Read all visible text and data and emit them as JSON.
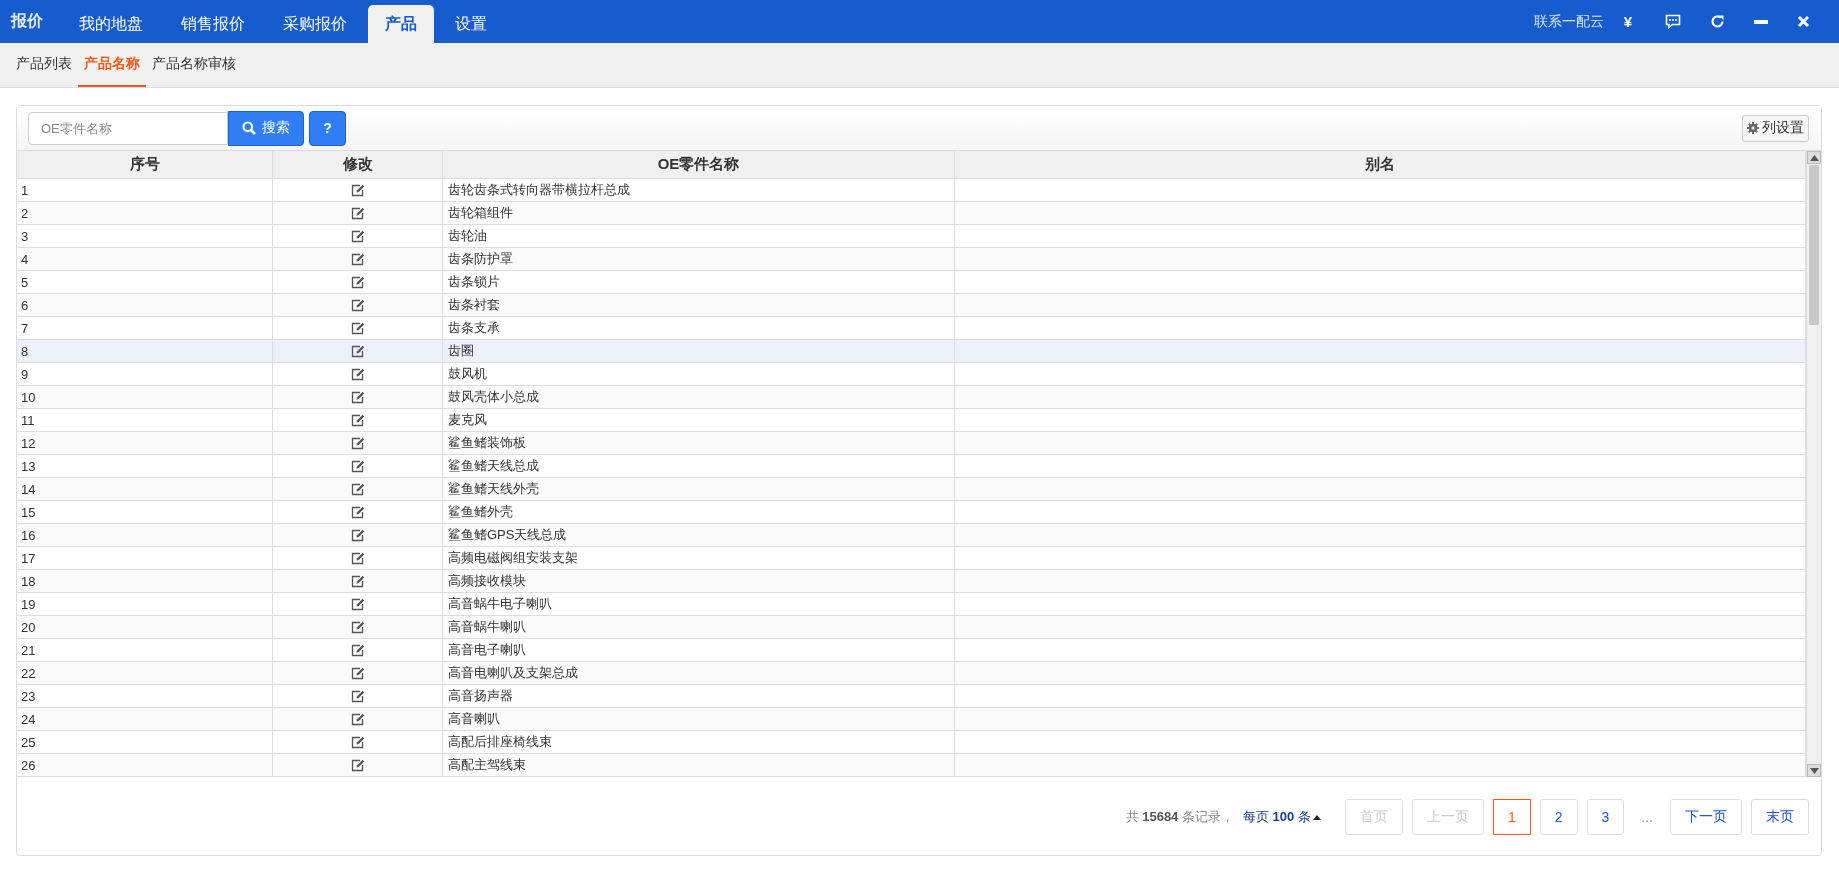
{
  "top_bar": {
    "brand": "报价",
    "tabs": [
      {
        "label": "我的地盘",
        "selected": false
      },
      {
        "label": "销售报价",
        "selected": false
      },
      {
        "label": "采购报价",
        "selected": false
      },
      {
        "label": "产品",
        "selected": true
      },
      {
        "label": "设置",
        "selected": false
      }
    ],
    "contact": "联系一配云",
    "currency": "¥"
  },
  "sub_tabs": [
    {
      "label": "产品列表",
      "selected": false
    },
    {
      "label": "产品名称",
      "selected": true
    },
    {
      "label": "产品名称审核",
      "selected": false
    }
  ],
  "toolbar": {
    "search": {
      "placeholder": "OE零件名称"
    },
    "search_button": "搜索",
    "help_button": "?",
    "column_settings": "列设置"
  },
  "table": {
    "columns": [
      "序号",
      "修改",
      "OE零件名称",
      "别名"
    ],
    "rows": [
      {
        "index": "1",
        "name": "齿轮齿条式转向器带横拉杆总成",
        "selected": false
      },
      {
        "index": "2",
        "name": "齿轮箱组件",
        "selected": false
      },
      {
        "index": "3",
        "name": "齿轮油",
        "selected": false
      },
      {
        "index": "4",
        "name": "齿条防护罩",
        "selected": false
      },
      {
        "index": "5",
        "name": "齿条锁片",
        "selected": false
      },
      {
        "index": "6",
        "name": "齿条衬套",
        "selected": false
      },
      {
        "index": "7",
        "name": "齿条支承",
        "selected": false
      },
      {
        "index": "8",
        "name": "齿圈",
        "selected": true
      },
      {
        "index": "9",
        "name": "鼓风机",
        "selected": false
      },
      {
        "index": "10",
        "name": "鼓风壳体小总成",
        "selected": false
      },
      {
        "index": "11",
        "name": "麦克风",
        "selected": false
      },
      {
        "index": "12",
        "name": "鲨鱼鳍装饰板",
        "selected": false
      },
      {
        "index": "13",
        "name": "鲨鱼鳍天线总成",
        "selected": false
      },
      {
        "index": "14",
        "name": "鲨鱼鳍天线外壳",
        "selected": false
      },
      {
        "index": "15",
        "name": "鲨鱼鳍外壳",
        "selected": false
      },
      {
        "index": "16",
        "name": "鲨鱼鳍GPS天线总成",
        "selected": false
      },
      {
        "index": "17",
        "name": "高频电磁阀组安装支架",
        "selected": false
      },
      {
        "index": "18",
        "name": "高频接收模块",
        "selected": false
      },
      {
        "index": "19",
        "name": "高音蜗牛电子喇叭",
        "selected": false
      },
      {
        "index": "20",
        "name": "高音蜗牛喇叭",
        "selected": false
      },
      {
        "index": "21",
        "name": "高音电子喇叭",
        "selected": false
      },
      {
        "index": "22",
        "name": "高音电喇叭及支架总成",
        "selected": false
      },
      {
        "index": "23",
        "name": "高音扬声器",
        "selected": false
      },
      {
        "index": "24",
        "name": "高音喇叭",
        "selected": false
      },
      {
        "index": "25",
        "name": "高配后排座椅线束",
        "selected": false
      },
      {
        "index": "26",
        "name": "高配主驾线束",
        "selected": false
      }
    ]
  },
  "pagination": {
    "total": "共 **15684** 条记录，",
    "page_size": "每页 **100** 条",
    "pages": [
      {
        "kind": "button",
        "label": "首页",
        "disabled": true,
        "selected": false
      },
      {
        "kind": "button",
        "label": "上一页",
        "disabled": true,
        "selected": false
      },
      {
        "kind": "button",
        "label": "1",
        "disabled": false,
        "selected": true
      },
      {
        "kind": "button",
        "label": "2",
        "disabled": false,
        "selected": false
      },
      {
        "kind": "button",
        "label": "3",
        "disabled": false,
        "selected": false
      },
      {
        "kind": "ellipsis",
        "label": "..."
      },
      {
        "kind": "button",
        "label": "下一页",
        "disabled": false,
        "selected": false
      },
      {
        "kind": "button",
        "label": "末页",
        "disabled": false,
        "selected": false
      }
    ]
  }
}
